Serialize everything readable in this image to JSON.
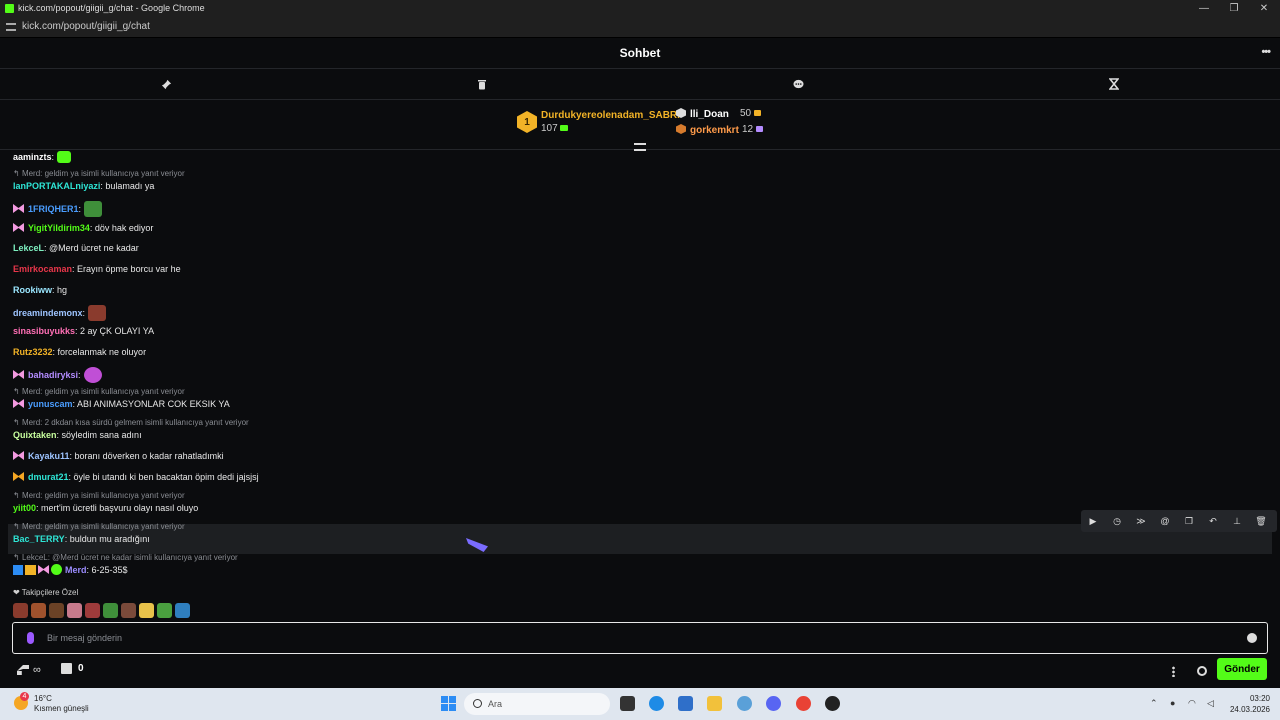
{
  "window": {
    "title": "kick.com/popout/giigii_g/chat - Google Chrome",
    "url": "kick.com/popout/giigii_g/chat",
    "controls": [
      "—",
      "❐",
      "✕"
    ]
  },
  "chat": {
    "header_title": "Sohbet",
    "more_label": "•••",
    "tools": [
      "pin-icon",
      "trash-icon",
      "speech-bubble-icon",
      "hourglass-icon"
    ]
  },
  "leaderboard": {
    "first": {
      "rank": "1",
      "name": "Durdukyereolenadam_SABRI",
      "count": "107"
    },
    "second": {
      "name": "lli_Doan",
      "count": "50"
    },
    "third": {
      "name": "gorkemkrt",
      "count": "12"
    }
  },
  "messages": [
    {
      "user": "aaminzts",
      "text": ":",
      "color": "#ffffff"
    },
    {
      "reply": "Merd: geldim ya isimli kullanıcıya yanıt veriyor"
    },
    {
      "user": "lanPORTAKALniyazi",
      "text": ": bulamadı ya",
      "color": "#2ee6d6"
    },
    {
      "user": "1FRIQHER1",
      "text": ":",
      "color": "#4a9dff"
    },
    {
      "user": "YigitYildirim34",
      "text": ": döv hak ediyor",
      "color": "#53fc18"
    },
    {
      "user": "LekceL",
      "text": ": @Merd ücret ne kadar",
      "color": "#7ef0c0",
      "mention": "@Merd"
    },
    {
      "user": "Emirkocaman",
      "text": ": Erayın öpme borcu var he",
      "color": "#e8364a"
    },
    {
      "user": "Rookiww",
      "text": ": hg",
      "color": "#9be7ff"
    },
    {
      "user": "dreamindemonx",
      "text": ":",
      "color": "#9ec4ff"
    },
    {
      "user": "sinasibuyukks",
      "text": ": 2 ay ÇK OLAYI YA",
      "color": "#ff6fb5"
    },
    {
      "user": "Rutz3232",
      "text": ": forcelanmak ne oluyor",
      "color": "#f2b327"
    },
    {
      "user": "bahadiryksi",
      "text": ":",
      "color": "#b48cff"
    },
    {
      "reply": "Merd: geldim ya isimli kullanıcıya yanıt veriyor"
    },
    {
      "user": "yunuscam",
      "text": ": ABI ANIMASYONLAR COK EKSIK YA",
      "color": "#4a9dff"
    },
    {
      "reply": "Merd: 2 dkdan kısa sürdü gelmem isimli kullanıcıya yanıt veriyor"
    },
    {
      "user": "Quixtaken",
      "text": ": söyledim sana adını",
      "color": "#c8ff9e"
    },
    {
      "user": "Kayaku11",
      "text": ": boranı döverken o kadar rahatladımki",
      "color": "#9ec4ff"
    },
    {
      "user": "dmurat21",
      "text": ": öyle bi utandı ki ben bacaktan öpim dedi jajsjsj",
      "color": "#2ee6d6"
    },
    {
      "reply": "Merd: geldim ya isimli kullanıcıya yanıt veriyor"
    },
    {
      "user": "yiit00",
      "text": ": mert'im ücretli başvuru olayı nasıl oluyo",
      "color": "#53fc18"
    },
    {
      "reply": "Merd: geldim ya isimli kullanıcıya yanıt veriyor"
    },
    {
      "user": "Bac_TERRY",
      "text": ": buldun mu aradığını",
      "color": "#2ee6d6"
    }
  ],
  "pinned": {
    "reply": "LekceL: @Merd ücret ne kadar isimli kullanıcıya yanıt veriyor",
    "user": "Merd",
    "text": ": 6-25-35$"
  },
  "followers_label": "❤ Takipçilere Özel",
  "input": {
    "placeholder": "Bir mesaj gönderin"
  },
  "bottom": {
    "points": "∞",
    "store_count": "0",
    "send_label": "Gönder"
  },
  "taskbar": {
    "weather_temp": "16°C",
    "weather_desc": "Kısmen güneşli",
    "weather_badge": "4",
    "search_label": "Ara",
    "time": "03:20",
    "date": "24.03.2026"
  },
  "accent": "#53fc18"
}
